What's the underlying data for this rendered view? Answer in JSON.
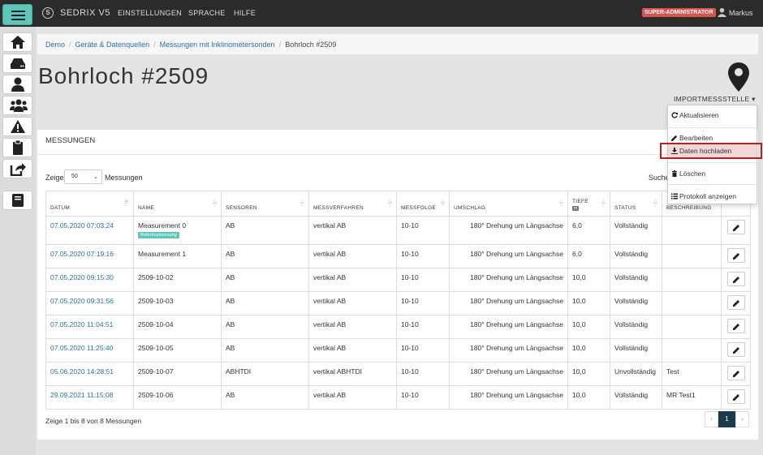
{
  "topbar": {
    "brand": "SEDRIX V5",
    "nav": [
      "EINSTELLUNGEN",
      "SPRACHE",
      "HILFE"
    ],
    "role": "SUPER-ADMINISTRATOR",
    "user": "Markus"
  },
  "sidebar": {
    "icons": [
      "home-icon",
      "server-icon",
      "user-icon",
      "users-icon",
      "warning-icon",
      "clipboard-icon",
      "share-icon",
      "book-icon"
    ]
  },
  "breadcrumb": [
    "Demo",
    "Geräte & Datenquellen",
    "Messungen mit Inklinometersonden",
    "Bohrloch #2509"
  ],
  "page": {
    "title": "Bohrloch #2509",
    "import_label": "IMPORTMESSSTELLE ▾"
  },
  "dropdown": {
    "items": [
      "Aktualisieren",
      "Bearbeiten",
      "Daten hochladen",
      "Löschen",
      "Protokoll anzeigen"
    ],
    "active": "Daten hochladen"
  },
  "panel": {
    "heading": "MESSUNGEN",
    "show_label": "Zeige",
    "page_size": "50",
    "show_after": "Messungen",
    "search_label": "Suche",
    "info": "Zeige 1 bis 8 von 8 Messungen",
    "page": "1"
  },
  "table": {
    "columns": [
      "DATUM",
      "NAME",
      "SENSOREN",
      "MESSVERFAHREN",
      "MESSFOLGE",
      "UMSCHLAG",
      "TIEFE",
      "STATUS",
      "BESCHREIBUNG"
    ],
    "depth_unit": "m",
    "badge": "Referenzmessung",
    "rows": [
      {
        "date": "07.05.2020 07:03:24",
        "name": "Measurement 0",
        "sensors": "AB",
        "method": "vertikal AB",
        "sequence": "10-10",
        "turn": "180° Drehung um Längsachse",
        "depth": "6,0",
        "status": "Vollständig",
        "desc": ""
      },
      {
        "date": "07.05.2020 07:19:16",
        "name": "Measurement 1",
        "sensors": "AB",
        "method": "vertikal AB",
        "sequence": "10-10",
        "turn": "180° Drehung um Längsachse",
        "depth": "6,0",
        "status": "Vollständig",
        "desc": ""
      },
      {
        "date": "07.05.2020 09:15:30",
        "name": "2509-10-02",
        "sensors": "AB",
        "method": "vertikal AB",
        "sequence": "10-10",
        "turn": "180° Drehung um Längsachse",
        "depth": "10,0",
        "status": "Vollständig",
        "desc": ""
      },
      {
        "date": "07.05.2020 09:31:56",
        "name": "2509-10-03",
        "sensors": "AB",
        "method": "vertikal AB",
        "sequence": "10-10",
        "turn": "180° Drehung um Längsachse",
        "depth": "10,0",
        "status": "Vollständig",
        "desc": ""
      },
      {
        "date": "07.05.2020 11:04:51",
        "name": "2509-10-04",
        "sensors": "AB",
        "method": "vertikal AB",
        "sequence": "10-10",
        "turn": "180° Drehung um Längsachse",
        "depth": "10,0",
        "status": "Vollständig",
        "desc": ""
      },
      {
        "date": "07.05.2020 11:25:40",
        "name": "2509-10-05",
        "sensors": "AB",
        "method": "vertikal AB",
        "sequence": "10-10",
        "turn": "180° Drehung um Längsachse",
        "depth": "10,0",
        "status": "Vollständig",
        "desc": ""
      },
      {
        "date": "05.06.2020 14:28:51",
        "name": "2509-10-07",
        "sensors": "ABHTDI",
        "method": "vertikal ABHTDI",
        "sequence": "10-10",
        "turn": "180° Drehung um Längsachse",
        "depth": "10,0",
        "status": "Unvollständig",
        "desc": "Test"
      },
      {
        "date": "29.09.2021 11:15:08",
        "name": "2509-10-06",
        "sensors": "AB",
        "method": "vertikal AB",
        "sequence": "10-10",
        "turn": "180° Drehung um Längsachse",
        "depth": "10,0",
        "status": "Vollständig",
        "desc": "MR Test1"
      }
    ]
  }
}
